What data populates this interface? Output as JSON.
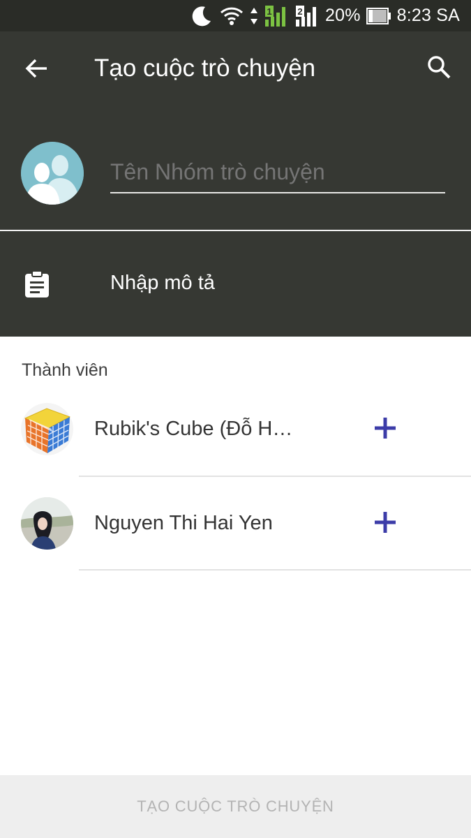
{
  "status_bar": {
    "battery": "20%",
    "time": "8:23 SA",
    "sim1_label": "1",
    "sim2_label": "2",
    "icons": [
      "moon-icon",
      "wifi-icon",
      "data-arrows-icon",
      "signal-sim1-icon",
      "signal-sim2-icon",
      "battery-icon"
    ]
  },
  "app_bar": {
    "title": "Tạo cuộc trò chuyện",
    "back_icon": "arrow-left-icon",
    "search_icon": "search-icon"
  },
  "group": {
    "name_placeholder": "Tên Nhóm trò chuyện",
    "name_value": "",
    "avatar_icon": "group-people-icon"
  },
  "description": {
    "placeholder": "Nhập mô tả",
    "icon": "clipboard-icon"
  },
  "members": {
    "label": "Thành viên",
    "items": [
      {
        "name": "Rubik's Cube (Đỗ H…",
        "avatar": "rubiks-cube-avatar",
        "action_icon": "plus-icon"
      },
      {
        "name": "Nguyen Thi Hai Yen",
        "avatar": "person-photo-avatar",
        "action_icon": "plus-icon"
      }
    ]
  },
  "footer": {
    "create_label": "TẠO CUỘC TRÒ CHUYỆN",
    "enabled": false
  },
  "colors": {
    "header_bg": "#363833",
    "status_bg": "#2a2c27",
    "accent_plus": "#3c3ca8",
    "avatar_bg": "#7fbfcc",
    "disabled_text": "#b3b3b3"
  }
}
